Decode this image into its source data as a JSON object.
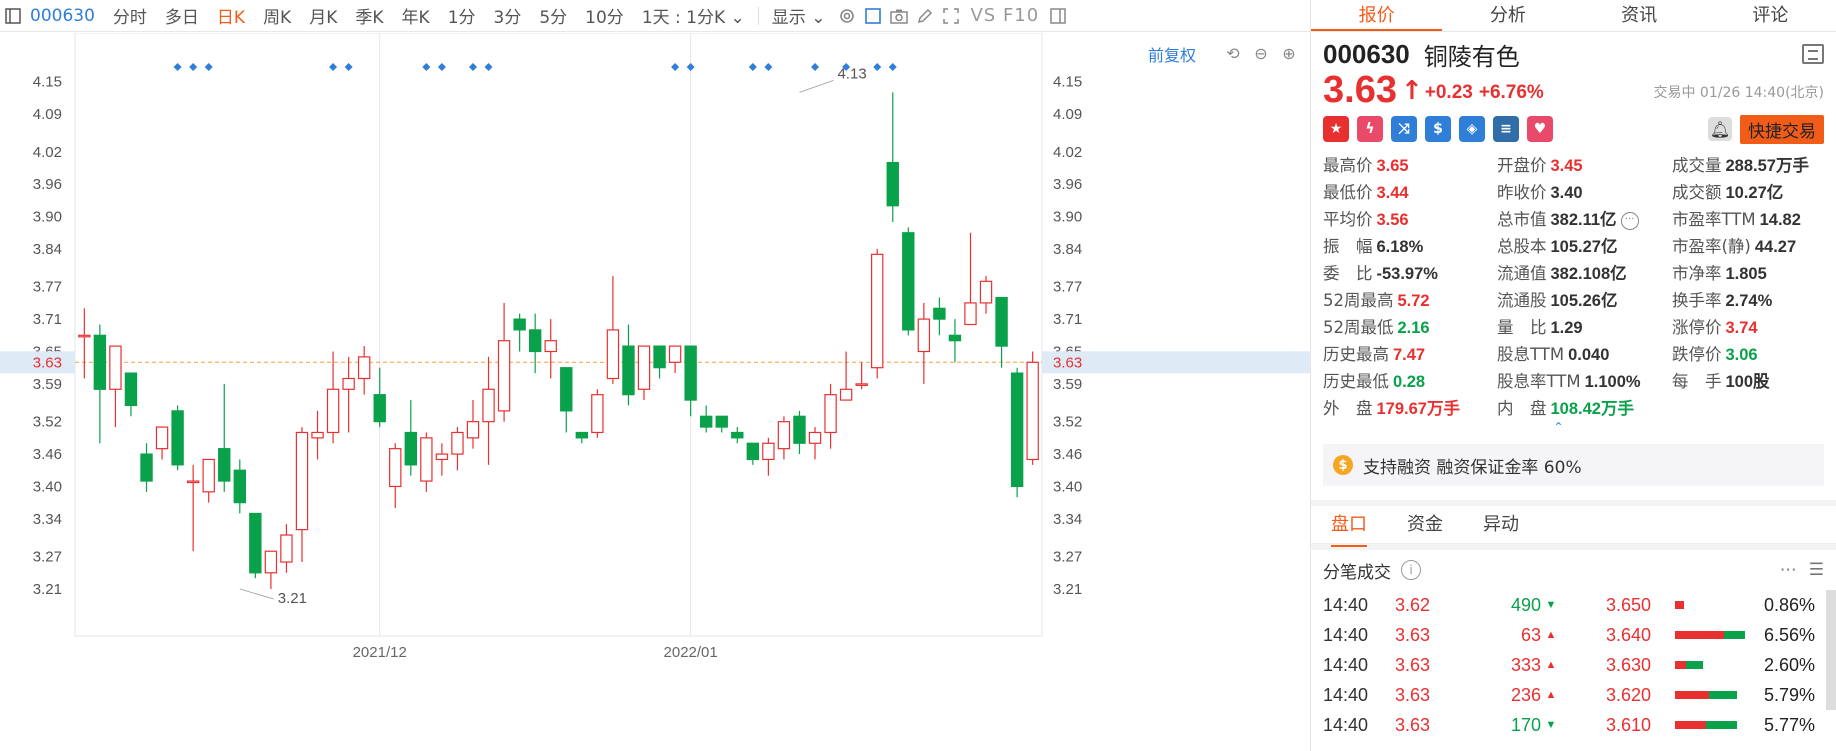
{
  "toolbar": {
    "code": "000630",
    "tabs": [
      "分时",
      "多日",
      "日K",
      "周K",
      "月K",
      "季K",
      "年K",
      "1分",
      "3分",
      "5分",
      "10分"
    ],
    "active_tab": "日K",
    "period_select": "1天 : 1分K",
    "display": "显示",
    "vs": "VS",
    "f10": "F10"
  },
  "chart_controls": {
    "restore": "前复权"
  },
  "chart_data": {
    "type": "candlestick",
    "ylim": [
      3.16,
      4.19
    ],
    "y_ticks": [
      4.15,
      4.09,
      4.02,
      3.96,
      3.9,
      3.84,
      3.77,
      3.71,
      3.65,
      3.59,
      3.52,
      3.46,
      3.4,
      3.34,
      3.27,
      3.21
    ],
    "x_labels": [
      {
        "label": "2021/12",
        "index": 19
      },
      {
        "label": "2022/01",
        "index": 39
      }
    ],
    "current_price": 3.63,
    "annotations": [
      {
        "label": "4.13",
        "index": 46,
        "value": 4.13
      },
      {
        "label": "3.21",
        "index": 10,
        "value": 3.21
      }
    ],
    "event_markers": [
      6,
      7,
      8,
      16,
      17,
      22,
      23,
      25,
      26,
      38,
      39,
      43,
      44,
      47,
      49,
      51,
      52
    ],
    "candles": [
      {
        "o": 3.68,
        "c": 3.68,
        "h": 3.73,
        "l": 3.6
      },
      {
        "o": 3.68,
        "c": 3.58,
        "h": 3.7,
        "l": 3.48
      },
      {
        "o": 3.58,
        "c": 3.66,
        "h": 3.66,
        "l": 3.51
      },
      {
        "o": 3.61,
        "c": 3.55,
        "h": 3.61,
        "l": 3.53
      },
      {
        "o": 3.46,
        "c": 3.41,
        "h": 3.48,
        "l": 3.39
      },
      {
        "o": 3.47,
        "c": 3.51,
        "h": 3.51,
        "l": 3.45
      },
      {
        "o": 3.54,
        "c": 3.44,
        "h": 3.55,
        "l": 3.43
      },
      {
        "o": 3.41,
        "c": 3.41,
        "h": 3.44,
        "l": 3.28
      },
      {
        "o": 3.39,
        "c": 3.45,
        "h": 3.45,
        "l": 3.37
      },
      {
        "o": 3.47,
        "c": 3.41,
        "h": 3.59,
        "l": 3.39
      },
      {
        "o": 3.43,
        "c": 3.37,
        "h": 3.45,
        "l": 3.35
      },
      {
        "o": 3.35,
        "c": 3.24,
        "h": 3.35,
        "l": 3.23
      },
      {
        "o": 3.24,
        "c": 3.28,
        "h": 3.28,
        "l": 3.21
      },
      {
        "o": 3.26,
        "c": 3.31,
        "h": 3.33,
        "l": 3.24
      },
      {
        "o": 3.32,
        "c": 3.5,
        "h": 3.51,
        "l": 3.26
      },
      {
        "o": 3.49,
        "c": 3.5,
        "h": 3.54,
        "l": 3.45
      },
      {
        "o": 3.5,
        "c": 3.58,
        "h": 3.65,
        "l": 3.48
      },
      {
        "o": 3.58,
        "c": 3.6,
        "h": 3.64,
        "l": 3.5
      },
      {
        "o": 3.6,
        "c": 3.64,
        "h": 3.66,
        "l": 3.57
      },
      {
        "o": 3.57,
        "c": 3.52,
        "h": 3.62,
        "l": 3.51
      },
      {
        "o": 3.4,
        "c": 3.47,
        "h": 3.48,
        "l": 3.36
      },
      {
        "o": 3.5,
        "c": 3.44,
        "h": 3.56,
        "l": 3.42
      },
      {
        "o": 3.41,
        "c": 3.49,
        "h": 3.5,
        "l": 3.39
      },
      {
        "o": 3.45,
        "c": 3.46,
        "h": 3.48,
        "l": 3.42
      },
      {
        "o": 3.46,
        "c": 3.5,
        "h": 3.51,
        "l": 3.43
      },
      {
        "o": 3.49,
        "c": 3.52,
        "h": 3.56,
        "l": 3.47
      },
      {
        "o": 3.52,
        "c": 3.58,
        "h": 3.64,
        "l": 3.44
      },
      {
        "o": 3.54,
        "c": 3.67,
        "h": 3.74,
        "l": 3.52
      },
      {
        "o": 3.71,
        "c": 3.69,
        "h": 3.72,
        "l": 3.65
      },
      {
        "o": 3.69,
        "c": 3.65,
        "h": 3.72,
        "l": 3.61
      },
      {
        "o": 3.65,
        "c": 3.67,
        "h": 3.71,
        "l": 3.6
      },
      {
        "o": 3.62,
        "c": 3.54,
        "h": 3.62,
        "l": 3.5
      },
      {
        "o": 3.5,
        "c": 3.49,
        "h": 3.5,
        "l": 3.48
      },
      {
        "o": 3.5,
        "c": 3.57,
        "h": 3.58,
        "l": 3.49
      },
      {
        "o": 3.6,
        "c": 3.69,
        "h": 3.79,
        "l": 3.59
      },
      {
        "o": 3.66,
        "c": 3.57,
        "h": 3.7,
        "l": 3.55
      },
      {
        "o": 3.58,
        "c": 3.66,
        "h": 3.66,
        "l": 3.56
      },
      {
        "o": 3.66,
        "c": 3.62,
        "h": 3.66,
        "l": 3.6
      },
      {
        "o": 3.63,
        "c": 3.66,
        "h": 3.66,
        "l": 3.61
      },
      {
        "o": 3.66,
        "c": 3.56,
        "h": 3.66,
        "l": 3.53
      },
      {
        "o": 3.53,
        "c": 3.51,
        "h": 3.55,
        "l": 3.5
      },
      {
        "o": 3.53,
        "c": 3.51,
        "h": 3.53,
        "l": 3.5
      },
      {
        "o": 3.5,
        "c": 3.49,
        "h": 3.51,
        "l": 3.48
      },
      {
        "o": 3.48,
        "c": 3.45,
        "h": 3.48,
        "l": 3.44
      },
      {
        "o": 3.45,
        "c": 3.48,
        "h": 3.49,
        "l": 3.42
      },
      {
        "o": 3.47,
        "c": 3.52,
        "h": 3.53,
        "l": 3.45
      },
      {
        "o": 3.53,
        "c": 3.48,
        "h": 3.54,
        "l": 3.46
      },
      {
        "o": 3.48,
        "c": 3.5,
        "h": 3.51,
        "l": 3.45
      },
      {
        "o": 3.5,
        "c": 3.57,
        "h": 3.59,
        "l": 3.47
      },
      {
        "o": 3.56,
        "c": 3.58,
        "h": 3.65,
        "l": 3.56
      },
      {
        "o": 3.59,
        "c": 3.59,
        "h": 3.63,
        "l": 3.58
      },
      {
        "o": 3.62,
        "c": 3.83,
        "h": 3.84,
        "l": 3.6
      },
      {
        "o": 4.0,
        "c": 3.92,
        "h": 4.13,
        "l": 3.89
      },
      {
        "o": 3.87,
        "c": 3.69,
        "h": 3.88,
        "l": 3.68
      },
      {
        "o": 3.65,
        "c": 3.71,
        "h": 3.74,
        "l": 3.59
      },
      {
        "o": 3.73,
        "c": 3.71,
        "h": 3.75,
        "l": 3.68
      },
      {
        "o": 3.68,
        "c": 3.67,
        "h": 3.71,
        "l": 3.63
      },
      {
        "o": 3.7,
        "c": 3.74,
        "h": 3.87,
        "l": 3.7
      },
      {
        "o": 3.74,
        "c": 3.78,
        "h": 3.79,
        "l": 3.72
      },
      {
        "o": 3.75,
        "c": 3.66,
        "h": 3.75,
        "l": 3.62
      },
      {
        "o": 3.61,
        "c": 3.4,
        "h": 3.62,
        "l": 3.38
      },
      {
        "o": 3.45,
        "c": 3.63,
        "h": 3.65,
        "l": 3.44
      }
    ]
  },
  "right_tabs": [
    "报价",
    "分析",
    "资讯",
    "评论"
  ],
  "quote": {
    "code": "000630",
    "name": "铜陵有色",
    "price": "3.63",
    "arrow": "↑",
    "change": "+0.23",
    "change_pct": "+6.76%",
    "status": "交易中 01/26 14:40(北京)",
    "fast_trade": "快捷交易"
  },
  "fields": [
    {
      "k": "最高价",
      "v": "3.65",
      "c": "up"
    },
    {
      "k": "开盘价",
      "v": "3.45",
      "c": "up"
    },
    {
      "k": "成交量",
      "v": "288.57万手",
      "c": "neutral"
    },
    {
      "k": "最低价",
      "v": "3.44",
      "c": "up"
    },
    {
      "k": "昨收价",
      "v": "3.40",
      "c": "neutral"
    },
    {
      "k": "成交额",
      "v": "10.27亿",
      "c": "neutral"
    },
    {
      "k": "平均价",
      "v": "3.56",
      "c": "up"
    },
    {
      "k": "总市值",
      "v": "382.11亿",
      "c": "neutral"
    },
    {
      "k": "市盈率TTM",
      "v": "14.82",
      "c": "neutral"
    },
    {
      "k": "振　幅",
      "v": "6.18%",
      "c": "neutral"
    },
    {
      "k": "总股本",
      "v": "105.27亿",
      "c": "neutral"
    },
    {
      "k": "市盈率(静)",
      "v": "44.27",
      "c": "neutral"
    },
    {
      "k": "委　比",
      "v": "-53.97%",
      "c": "neutral"
    },
    {
      "k": "流通值",
      "v": "382.108亿",
      "c": "neutral"
    },
    {
      "k": "市净率",
      "v": "1.805",
      "c": "neutral"
    },
    {
      "k": "52周最高",
      "v": "5.72",
      "c": "up"
    },
    {
      "k": "流通股",
      "v": "105.26亿",
      "c": "neutral"
    },
    {
      "k": "换手率",
      "v": "2.74%",
      "c": "neutral"
    },
    {
      "k": "52周最低",
      "v": "2.16",
      "c": "down"
    },
    {
      "k": "量　比",
      "v": "1.29",
      "c": "neutral"
    },
    {
      "k": "涨停价",
      "v": "3.74",
      "c": "up"
    },
    {
      "k": "历史最高",
      "v": "7.47",
      "c": "up"
    },
    {
      "k": "股息TTM",
      "v": "0.040",
      "c": "neutral"
    },
    {
      "k": "跌停价",
      "v": "3.06",
      "c": "down"
    },
    {
      "k": "历史最低",
      "v": "0.28",
      "c": "down"
    },
    {
      "k": "股息率TTM",
      "v": "1.100%",
      "c": "neutral"
    },
    {
      "k": "每　手",
      "v": "100股",
      "c": "neutral"
    },
    {
      "k": "外　盘",
      "v": "179.67万手",
      "c": "up"
    },
    {
      "k": "内　盘",
      "v": "108.42万手",
      "c": "down"
    },
    {
      "k": "",
      "v": "",
      "c": "neutral"
    }
  ],
  "margin_text": "支持融资 融资保证金率 60%",
  "sub_tabs": [
    "盘口",
    "资金",
    "异动"
  ],
  "ticks_title": "分笔成交",
  "ticks": [
    {
      "time": "14:40",
      "price": "3.62",
      "vol": "490",
      "dir": "down",
      "lvl": "3.650",
      "pct": "0.86%",
      "pct_val": 0.86,
      "green_frac": 0
    },
    {
      "time": "14:40",
      "price": "3.63",
      "vol": "63",
      "dir": "up",
      "lvl": "3.640",
      "pct": "6.56%",
      "pct_val": 6.56,
      "green_frac": 0.3
    },
    {
      "time": "14:40",
      "price": "3.63",
      "vol": "333",
      "dir": "up",
      "lvl": "3.630",
      "pct": "2.60%",
      "pct_val": 2.6,
      "green_frac": 0.6
    },
    {
      "time": "14:40",
      "price": "3.63",
      "vol": "236",
      "dir": "up",
      "lvl": "3.620",
      "pct": "5.79%",
      "pct_val": 5.79,
      "green_frac": 0.45
    },
    {
      "time": "14:40",
      "price": "3.63",
      "vol": "170",
      "dir": "down",
      "lvl": "3.610",
      "pct": "5.77%",
      "pct_val": 5.77,
      "green_frac": 0.5
    }
  ],
  "colors": {
    "up": "#e93030",
    "down": "#0aa14b",
    "accent": "#f25c19",
    "link": "#2f7ed8"
  }
}
